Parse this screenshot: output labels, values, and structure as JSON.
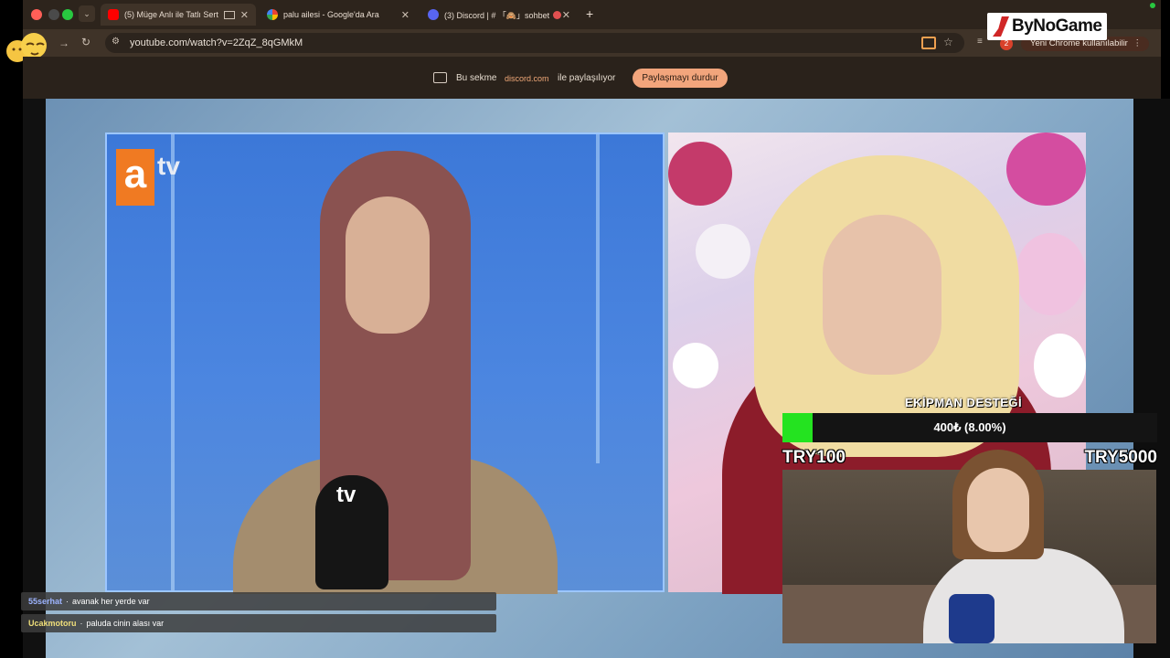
{
  "browser": {
    "tabs": [
      {
        "title": "(5) Müge Anlı ile Tatlı Sert",
        "active": true
      },
      {
        "title": "palu ailesi - Google'da Ara",
        "active": false
      },
      {
        "title": "(3) Discord | # 「🙈」sohbet",
        "active": false
      }
    ],
    "new_tab": "+",
    "url": "youtube.com/watch?v=2ZqZ_8qGMkM",
    "notification_count": "2",
    "update_message": "Yeni Chrome kullanılabilir"
  },
  "share_bar": {
    "text_before": "Bu sekme",
    "domain": "discord.com",
    "text_after": "ile paylaşılıyor",
    "stop_button": "Paylaşmayı durdur"
  },
  "video": {
    "channel_logo_a": "a",
    "channel_logo_tv": "tv",
    "mic_logo": "tv"
  },
  "donation_goal": {
    "title": "EKİPMAN DESTEĞİ",
    "progress_text": "400₺ (8.00%)",
    "progress_fraction": 0.08,
    "min_label": "TRY100",
    "max_label": "TRY5000",
    "fill_color": "#24e320"
  },
  "chat": [
    {
      "user": "55serhat",
      "message": "avanak her yerde var",
      "user_color": "#9db4ff"
    },
    {
      "user": "Ucakmotoru",
      "message": "paluda cinin alası var",
      "user_color": "#f0df7a"
    }
  ],
  "watermark": {
    "brand": "ByNoGame"
  }
}
